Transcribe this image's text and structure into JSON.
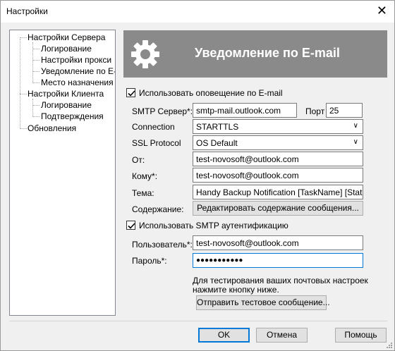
{
  "window": {
    "title": "Настройки",
    "close_glyph": "✕"
  },
  "tree": {
    "items": [
      {
        "label": "Настройки Сервера"
      },
      {
        "label": "Логирование"
      },
      {
        "label": "Настройки прокси"
      },
      {
        "label": "Уведомление по E-mail"
      },
      {
        "label": "Место назначения"
      },
      {
        "label": "Настройки Клиента"
      },
      {
        "label": "Логирование"
      },
      {
        "label": "Подтверждения"
      },
      {
        "label": "Обновления"
      }
    ]
  },
  "banner": {
    "title": "Уведомление по E-mail",
    "icon": "gear-icon"
  },
  "form": {
    "use_email_notify": {
      "label": "Использовать оповещение по E-mail",
      "checked": true
    },
    "smtp_server": {
      "label": "SMTP Сервер*:",
      "value": "smtp-mail.outlook.com"
    },
    "port": {
      "label": "Порт",
      "value": "25"
    },
    "connection": {
      "label": "Connection",
      "value": "STARTTLS"
    },
    "ssl_protocol": {
      "label": "SSL Protocol",
      "value": "OS Default"
    },
    "from": {
      "label": "От:",
      "value": "test-novosoft@outlook.com"
    },
    "to": {
      "label": "Кому*:",
      "value": "test-novosoft@outlook.com"
    },
    "subject": {
      "label": "Тема:",
      "value": "Handy Backup Notification [TaskName] [Status"
    },
    "content": {
      "label": "Содержание:",
      "button": "Редактировать содержание сообщения..."
    },
    "use_smtp_auth": {
      "label": "Использовать SMTP аутентификацию",
      "checked": true
    },
    "user": {
      "label": "Пользователь*:",
      "value": "test-novosoft@outlook.com"
    },
    "password": {
      "label": "Пароль*:",
      "value": "●●●●●●●●●●●"
    },
    "test_hint_line1": "Для тестирования ваших почтовых настроек",
    "test_hint_line2": "нажмите кнопку ниже.",
    "test_button": "Отправить тестовое сообщение..."
  },
  "footer": {
    "ok": "OK",
    "cancel": "Отмена",
    "help": "Помощь"
  }
}
